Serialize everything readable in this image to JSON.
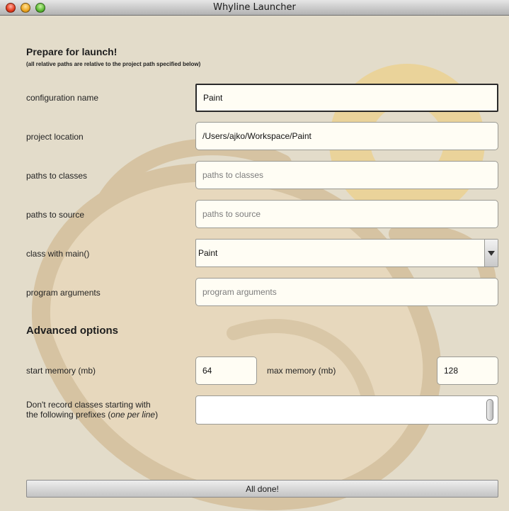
{
  "window": {
    "title": "Whyline Launcher"
  },
  "header": {
    "title": "Prepare for launch!",
    "subtitle": "(all relative paths are relative to the project path specified below)"
  },
  "form": {
    "configuration_name": {
      "label": "configuration name",
      "value": "Paint"
    },
    "project_location": {
      "label": "project location",
      "value": "/Users/ajko/Workspace/Paint"
    },
    "paths_to_classes": {
      "label": "paths to classes",
      "placeholder": "paths to classes"
    },
    "paths_to_source": {
      "label": "paths to source",
      "placeholder": "paths to source"
    },
    "class_with_main": {
      "label": "class with main()",
      "value": "Paint"
    },
    "program_arguments": {
      "label": "program arguments",
      "placeholder": "program arguments"
    }
  },
  "advanced": {
    "title": "Advanced options",
    "start_memory": {
      "label": "start memory (mb)",
      "value": "64"
    },
    "max_memory": {
      "label": "max memory (mb)",
      "value": "128"
    },
    "exclude_prefixes": {
      "label_line1": "Don't record classes starting with",
      "label_line2_prefix": "the following prefixes (",
      "label_line2_emphasis": "one per line",
      "label_line2_suffix": ")"
    }
  },
  "footer": {
    "done_label": "All done!"
  },
  "colors": {
    "background": "#e3dcca",
    "bg_art_stroke": "#d6c3a2",
    "bg_art_fill": "#e7d8bd",
    "bg_art_accent": "#ecd089",
    "field_background": "#fffdf4"
  },
  "icons": {
    "close": "close-button",
    "minimize": "minimize-button",
    "zoom": "zoom-button",
    "dropdown": "triangle-down-icon"
  }
}
